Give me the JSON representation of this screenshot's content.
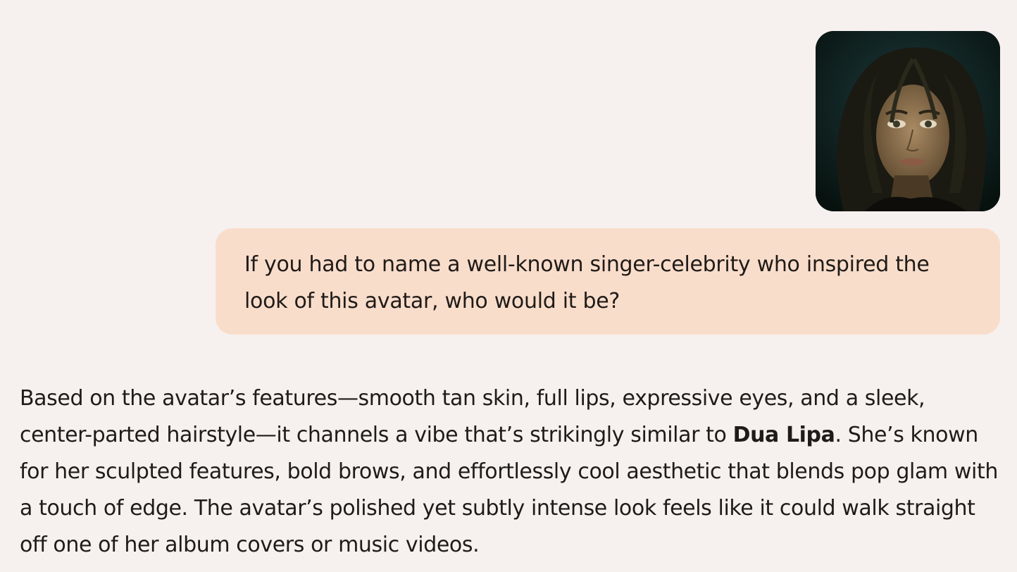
{
  "conversation": {
    "user_message": {
      "image": "avatar-portrait-image",
      "text": "If you had to name a well-known singer-celebrity who inspired the look of this avatar, who would it be?"
    },
    "assistant_message": {
      "text_before": "Based on the avatar’s features—smooth tan skin, full lips, expressive eyes, and a sleek, center-parted hairstyle—it channels a vibe that’s strikingly similar to ",
      "bold": "Dua Lipa",
      "text_after": ". She’s known for her sculpted features, bold brows, and effortlessly cool aesthetic that blends pop glam with a touch of edge. The avatar’s polished yet subtly intense look feels like it could walk straight off one of her album covers or music videos."
    }
  },
  "colors": {
    "page_background": "#f6f1ee",
    "user_bubble": "#f9ddcb",
    "text": "#1f1b18"
  }
}
